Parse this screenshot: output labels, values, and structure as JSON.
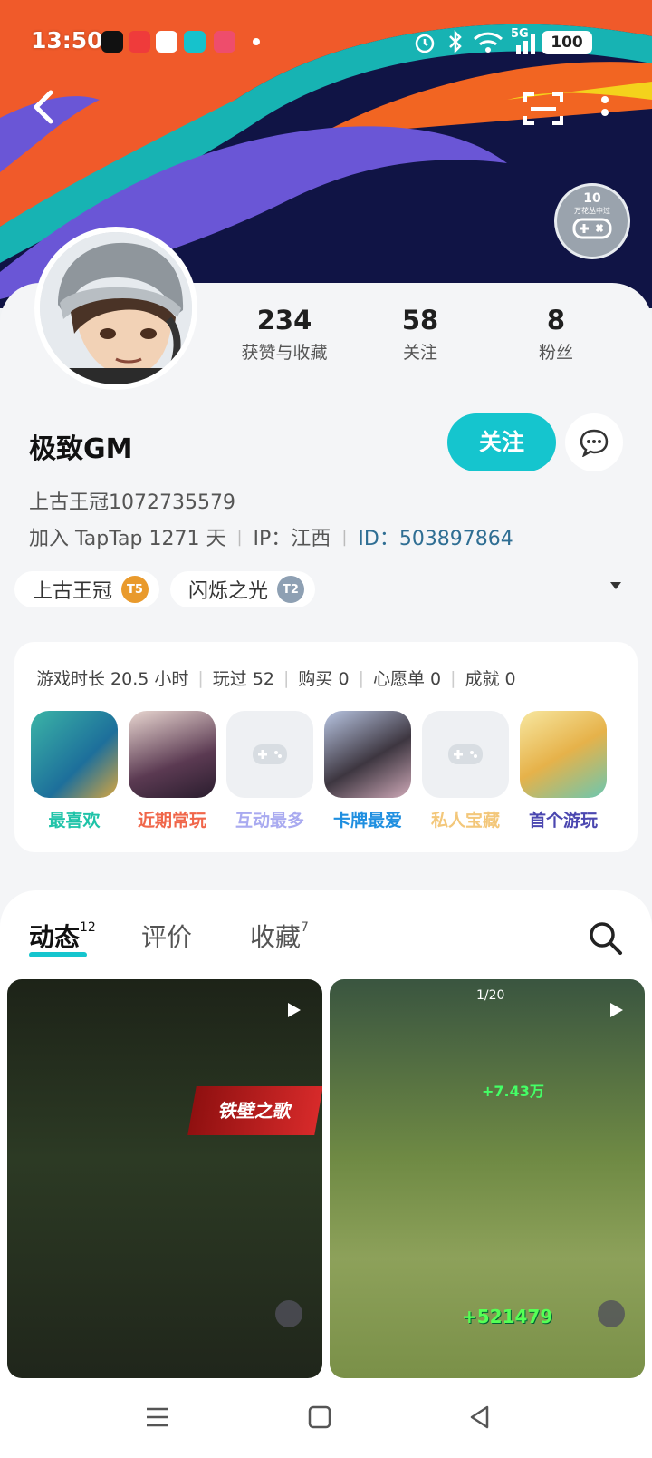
{
  "status": {
    "time": "13:50",
    "battery": "100",
    "network": "5G"
  },
  "header": {
    "back_icon": "back-icon",
    "scan_icon": "scan-icon",
    "more_icon": "more-icon",
    "badge_num": "10",
    "badge_text": "万花丛中过"
  },
  "profile": {
    "name": "极致GM",
    "follow_label": "关注",
    "subtitle": "上古王冠1072735579",
    "joined": "加入 TapTap 1271 天",
    "ip": "IP：江西",
    "uid": "ID：503897864",
    "stats": [
      {
        "num": "234",
        "label": "获赞与收藏"
      },
      {
        "num": "58",
        "label": "关注"
      },
      {
        "num": "8",
        "label": "粉丝"
      }
    ],
    "tags": [
      {
        "label": "上古王冠",
        "medal": "T5",
        "color": "#e99a2c"
      },
      {
        "label": "闪烁之光",
        "medal": "T2",
        "color": "#8ea0b3"
      }
    ]
  },
  "games": {
    "stats": [
      "游戏时长 20.5 小时",
      "玩过 52",
      "购买 0",
      "心愿单 0",
      "成就 0"
    ],
    "items": [
      {
        "label": "最喜欢",
        "color": "#1fc3a8"
      },
      {
        "label": "近期常玩",
        "color": "#f0664a"
      },
      {
        "label": "互动最多",
        "color": "#a9aaf0"
      },
      {
        "label": "卡牌最爱",
        "color": "#1f8fe0"
      },
      {
        "label": "私人宝藏",
        "color": "#f3c77a"
      },
      {
        "label": "首个游玩",
        "color": "#4b47b0"
      }
    ]
  },
  "tabs": {
    "feed": "动态",
    "feed_count": "12",
    "reviews": "评价",
    "collect": "收藏",
    "collect_count": "7"
  },
  "posts": {
    "left_label": "铁壁之歌",
    "right_counter": "1/20",
    "right_hp": "+7.43万",
    "right_damage": "+521479"
  }
}
